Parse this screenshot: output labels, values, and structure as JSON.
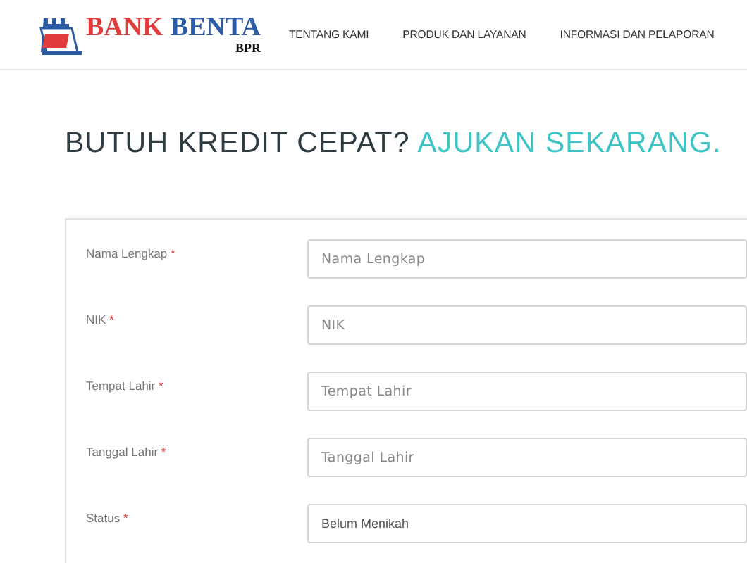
{
  "header": {
    "brand": [
      {
        "text": "BANK",
        "color": "#e23b3b"
      },
      {
        "text": "BENTA",
        "color": "#2d5ca6"
      }
    ],
    "brand_sub": "BPR",
    "nav": [
      {
        "label": "TENTANG KAMI"
      },
      {
        "label": "PRODUK DAN LAYANAN"
      },
      {
        "label": "INFORMASI DAN PELAPORAN"
      }
    ]
  },
  "heading": {
    "text": "BUTUH KREDIT CEPAT?",
    "highlight": "AJUKAN SEKARANG."
  },
  "form": {
    "fields": [
      {
        "label": "Nama Lengkap",
        "required_mark": "*",
        "kind": "text",
        "placeholder": "Nama Lengkap"
      },
      {
        "label": "NIK",
        "required_mark": "*",
        "kind": "text",
        "placeholder": "NIK"
      },
      {
        "label": "Tempat Lahir",
        "required_mark": "*",
        "kind": "text",
        "placeholder": "Tempat Lahir"
      },
      {
        "label": "Tanggal Lahir",
        "required_mark": "*",
        "kind": "text",
        "placeholder": "Tanggal Lahir"
      },
      {
        "label": "Status",
        "required_mark": "*",
        "kind": "select",
        "value": "Belum Menikah"
      }
    ]
  }
}
